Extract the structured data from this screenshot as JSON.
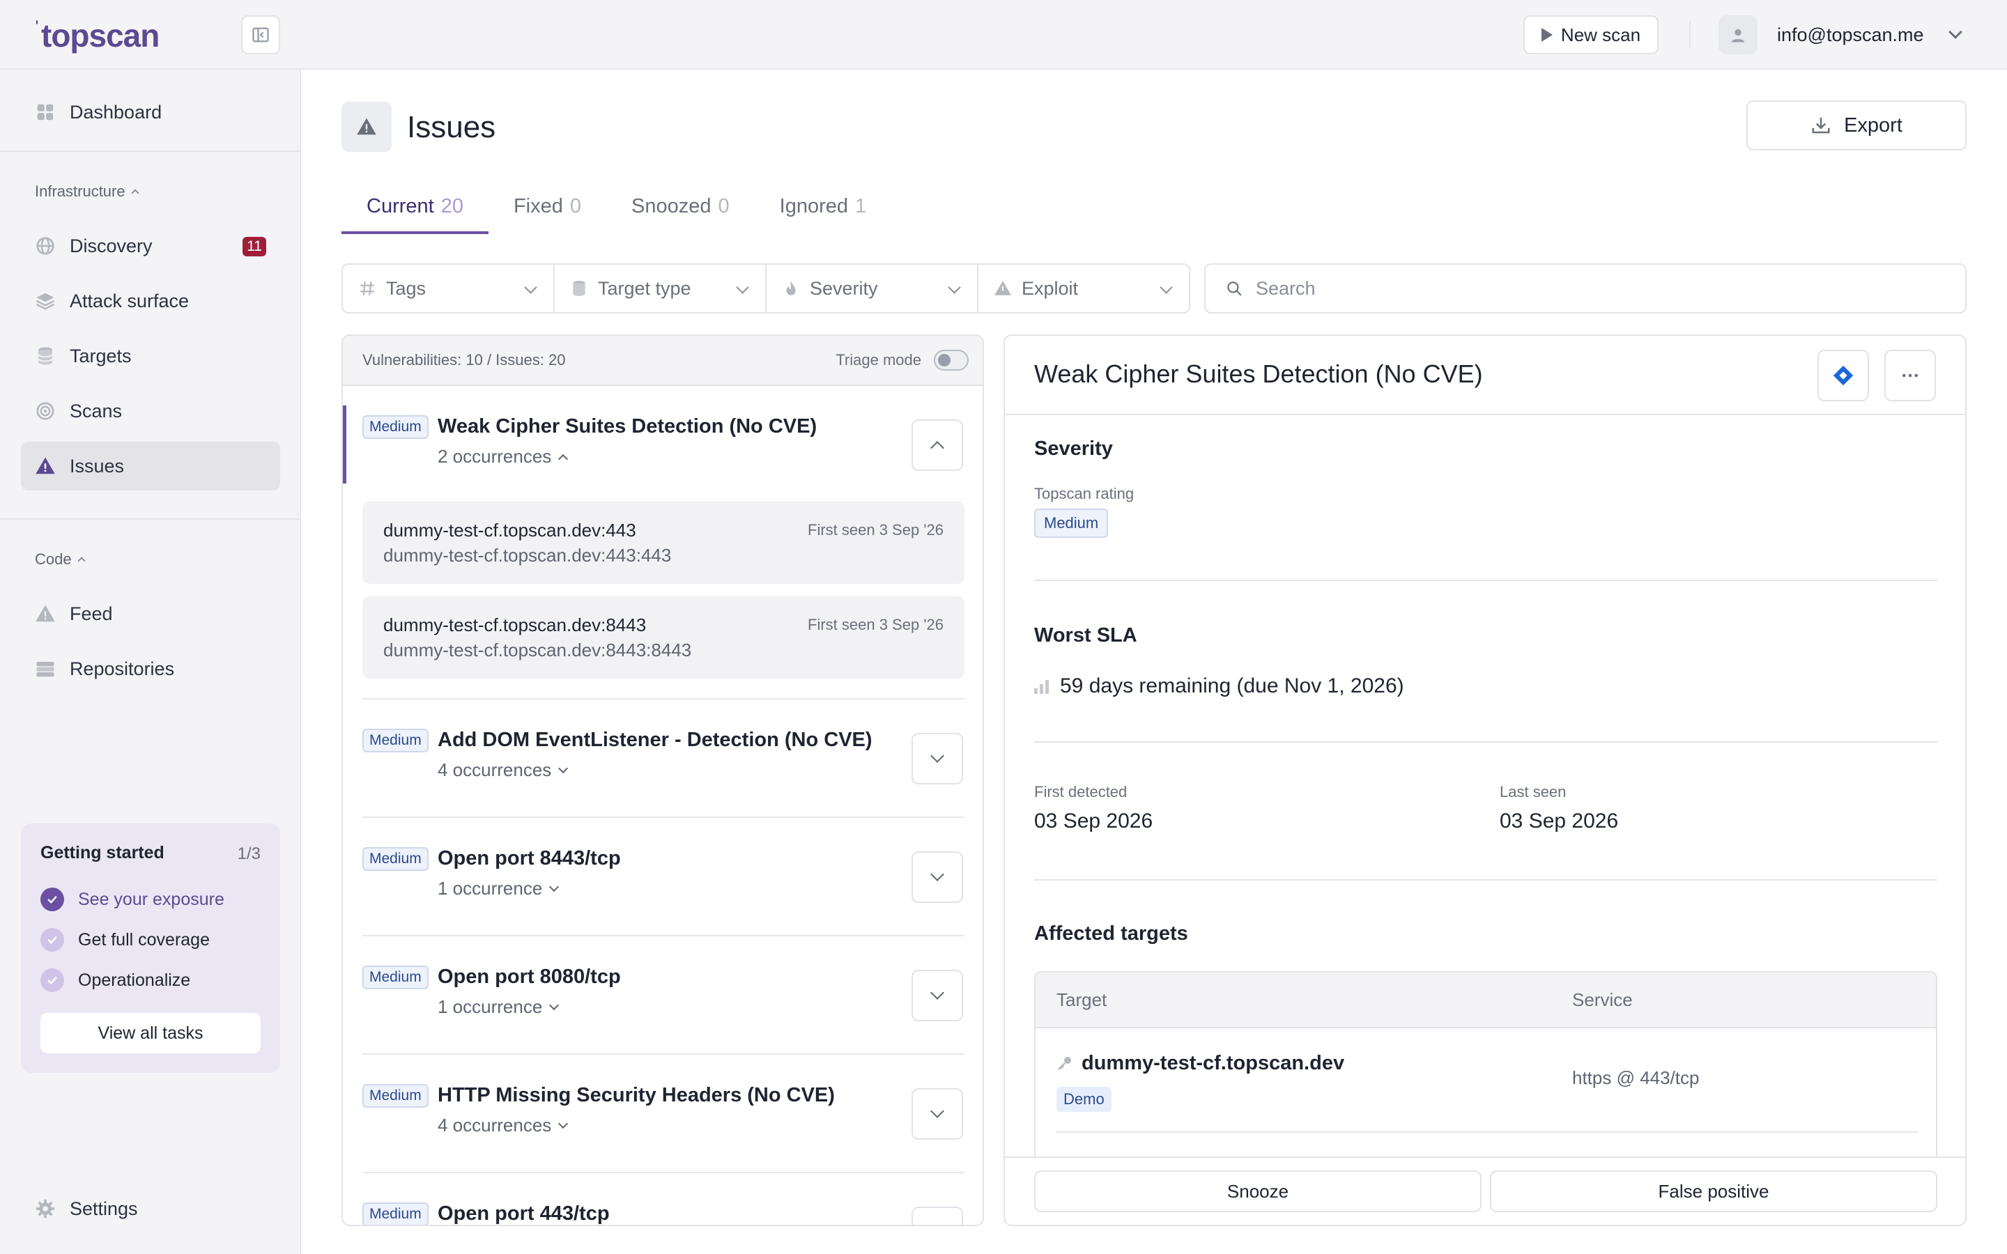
{
  "brand": {
    "logo": "topscan"
  },
  "topbar": {
    "new_scan_label": "New scan",
    "user_email": "info@topscan.me"
  },
  "sidebar": {
    "dashboard": "Dashboard",
    "infrastructure_label": "Infrastructure",
    "infra_items": [
      {
        "label": "Discovery",
        "icon": "globe-icon",
        "badge": "11"
      },
      {
        "label": "Attack surface",
        "icon": "layers-icon"
      },
      {
        "label": "Targets",
        "icon": "database-icon"
      },
      {
        "label": "Scans",
        "icon": "radar-icon"
      },
      {
        "label": "Issues",
        "icon": "warning-icon",
        "active": true
      }
    ],
    "code_label": "Code",
    "code_items": [
      {
        "label": "Feed",
        "icon": "warning-icon"
      },
      {
        "label": "Repositories",
        "icon": "server-icon"
      }
    ],
    "getting_started": {
      "title": "Getting started",
      "progress": "1/3",
      "tasks": [
        {
          "label": "See your exposure",
          "done": true
        },
        {
          "label": "Get full coverage",
          "done": false
        },
        {
          "label": "Operationalize",
          "done": false
        }
      ],
      "button": "View all tasks"
    },
    "settings": "Settings"
  },
  "page": {
    "title": "Issues",
    "export_label": "Export",
    "tabs": [
      {
        "label": "Current",
        "count": "20",
        "active": true
      },
      {
        "label": "Fixed",
        "count": "0"
      },
      {
        "label": "Snoozed",
        "count": "0"
      },
      {
        "label": "Ignored",
        "count": "1"
      }
    ],
    "filters": [
      {
        "label": "Tags",
        "icon": "hash-icon"
      },
      {
        "label": "Target type",
        "icon": "database-icon"
      },
      {
        "label": "Severity",
        "icon": "flame-icon"
      },
      {
        "label": "Exploit",
        "icon": "warning-icon"
      }
    ],
    "search_placeholder": "Search"
  },
  "list": {
    "summary": "Vulnerabilities: 10 / Issues: 20",
    "triage_label": "Triage mode",
    "issues": [
      {
        "severity": "Medium",
        "title": "Weak Cipher Suites Detection (No CVE)",
        "occurrences": "2 occurrences",
        "expanded": true,
        "items": [
          {
            "host": "dummy-test-cf.topscan.dev:443",
            "sub": "dummy-test-cf.topscan.dev:443:443",
            "seen": "First seen 3 Sep '26"
          },
          {
            "host": "dummy-test-cf.topscan.dev:8443",
            "sub": "dummy-test-cf.topscan.dev:8443:8443",
            "seen": "First seen 3 Sep '26"
          }
        ]
      },
      {
        "severity": "Medium",
        "title": "Add DOM EventListener - Detection (No CVE)",
        "occurrences": "4 occurrences"
      },
      {
        "severity": "Medium",
        "title": "Open port 8443/tcp",
        "occurrences": "1 occurrence"
      },
      {
        "severity": "Medium",
        "title": "Open port 8080/tcp",
        "occurrences": "1 occurrence"
      },
      {
        "severity": "Medium",
        "title": "HTTP Missing Security Headers (No CVE)",
        "occurrences": "4 occurrences"
      },
      {
        "severity": "Medium",
        "title": "Open port 443/tcp",
        "occurrences": ""
      }
    ]
  },
  "detail": {
    "title": "Weak Cipher Suites Detection (No CVE)",
    "severity_heading": "Severity",
    "rating_label": "Topscan rating",
    "rating_value": "Medium",
    "sla_heading": "Worst SLA",
    "sla_text": "59 days remaining (due Nov 1, 2026)",
    "first_detected_label": "First detected",
    "first_detected_value": "03 Sep 2026",
    "last_seen_label": "Last seen",
    "last_seen_value": "03 Sep 2026",
    "affected_heading": "Affected targets",
    "table": {
      "col_target": "Target",
      "col_service": "Service",
      "rows": [
        {
          "target": "dummy-test-cf.topscan.dev",
          "tag": "Demo",
          "service": "https @ 443/tcp"
        }
      ]
    },
    "snooze_label": "Snooze",
    "false_positive_label": "False positive"
  },
  "colors": {
    "accent": "#6b4fa3",
    "brand": "#5b4a91",
    "badge_red": "#9e1f3a",
    "jira_blue": "#1868db"
  }
}
